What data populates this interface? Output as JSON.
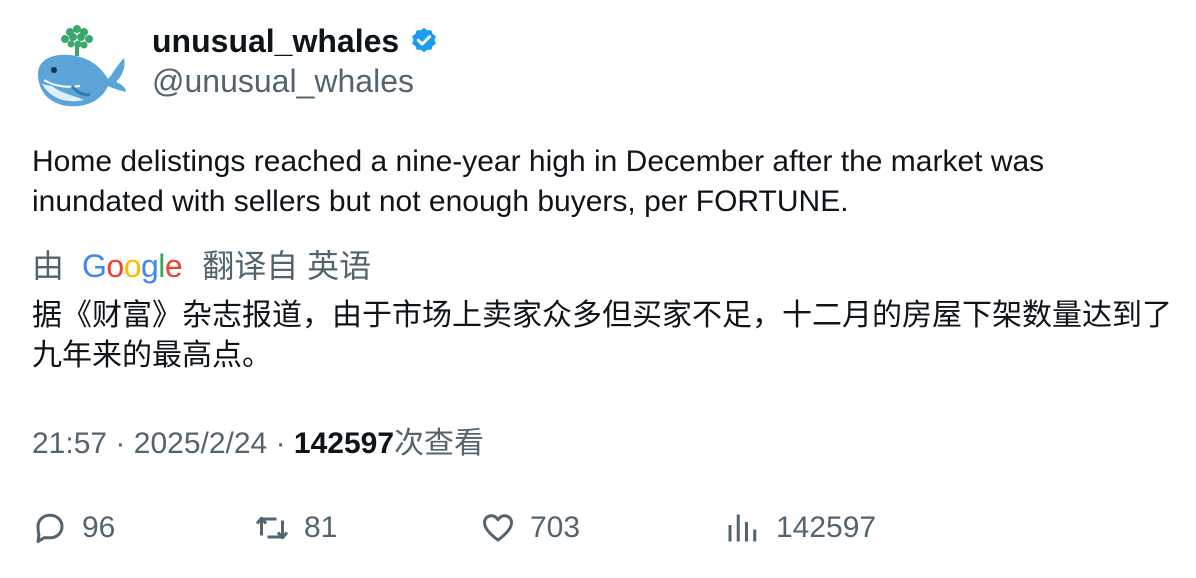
{
  "author": {
    "display_name": "unusual_whales",
    "handle": "@unusual_whales",
    "verified_color": "#1d9bf0"
  },
  "tweet": {
    "text": "Home delistings reached a nine-year high in December after the market was inundated with sellers but not enough buyers, per FORTUNE."
  },
  "translation": {
    "by_label": "由",
    "provider": "Google",
    "from_label": "翻译自 英语",
    "text": "据《财富》杂志报道，由于市场上卖家众多但买家不足，十二月的房屋下架数量达到了九年来的最高点。"
  },
  "meta": {
    "time": "21:57",
    "separator": "·",
    "date": "2025/2/24",
    "views": "142597",
    "views_label": "次查看"
  },
  "actions": {
    "replies": "96",
    "retweets": "81",
    "likes": "703",
    "views": "142597"
  },
  "icons": [
    "whale-avatar-icon",
    "verified-badge-icon",
    "reply-icon",
    "retweet-icon",
    "like-icon",
    "views-icon"
  ]
}
